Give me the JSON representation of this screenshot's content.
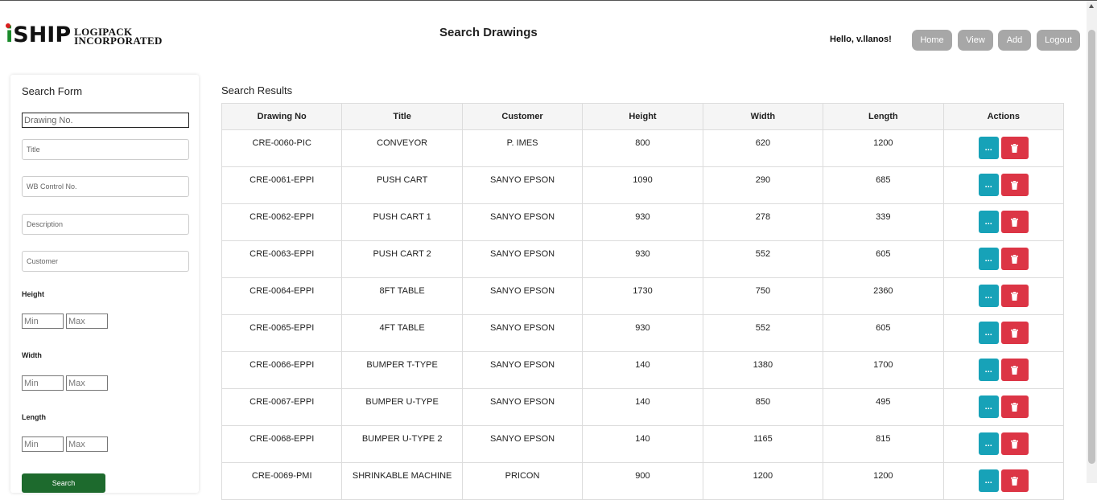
{
  "header": {
    "logo_main": "SHIP",
    "logo_line1": "LOGIPACK",
    "logo_line2": "INCORPORATED",
    "title": "Search Drawings",
    "greeting": "Hello, v.llanos!",
    "nav": [
      "Home",
      "View",
      "Add",
      "Logout"
    ]
  },
  "form": {
    "title": "Search Form",
    "drawing_no_placeholder": "Drawing No.",
    "title_placeholder": "Title",
    "wb_placeholder": "WB Control No.",
    "description_placeholder": "Description",
    "customer_placeholder": "Customer",
    "height_label": "Height",
    "width_label": "Width",
    "length_label": "Length",
    "min_placeholder": "Min",
    "max_placeholder": "Max",
    "search_label": "Search"
  },
  "results": {
    "title": "Search Results",
    "columns": [
      "Drawing No",
      "Title",
      "Customer",
      "Height",
      "Width",
      "Length",
      "Actions"
    ],
    "more_label": "...",
    "rows": [
      [
        "CRE-0060-PIC",
        "CONVEYOR",
        "P. IMES",
        "800",
        "620",
        "1200"
      ],
      [
        "CRE-0061-EPPI",
        "PUSH CART",
        "SANYO EPSON",
        "1090",
        "290",
        "685"
      ],
      [
        "CRE-0062-EPPI",
        "PUSH CART 1",
        "SANYO EPSON",
        "930",
        "278",
        "339"
      ],
      [
        "CRE-0063-EPPI",
        "PUSH CART 2",
        "SANYO EPSON",
        "930",
        "552",
        "605"
      ],
      [
        "CRE-0064-EPPI",
        "8FT TABLE",
        "SANYO EPSON",
        "1730",
        "750",
        "2360"
      ],
      [
        "CRE-0065-EPPI",
        "4FT TABLE",
        "SANYO EPSON",
        "930",
        "552",
        "605"
      ],
      [
        "CRE-0066-EPPI",
        "BUMPER T-TYPE",
        "SANYO EPSON",
        "140",
        "1380",
        "1700"
      ],
      [
        "CRE-0067-EPPI",
        "BUMPER U-TYPE",
        "SANYO EPSON",
        "140",
        "850",
        "495"
      ],
      [
        "CRE-0068-EPPI",
        "BUMPER U-TYPE 2",
        "SANYO EPSON",
        "140",
        "1165",
        "815"
      ],
      [
        "CRE-0069-PMI",
        "SHRINKABLE MACHINE",
        "PRICON",
        "900",
        "1200",
        "1200"
      ]
    ]
  },
  "colors": {
    "nav_button": "#a7a7a7",
    "search_button": "#1d6a2d",
    "more_button": "#17a2b8",
    "delete_button": "#dc3545"
  },
  "icons": {
    "more": "ellipsis-icon",
    "delete": "trash-icon"
  }
}
